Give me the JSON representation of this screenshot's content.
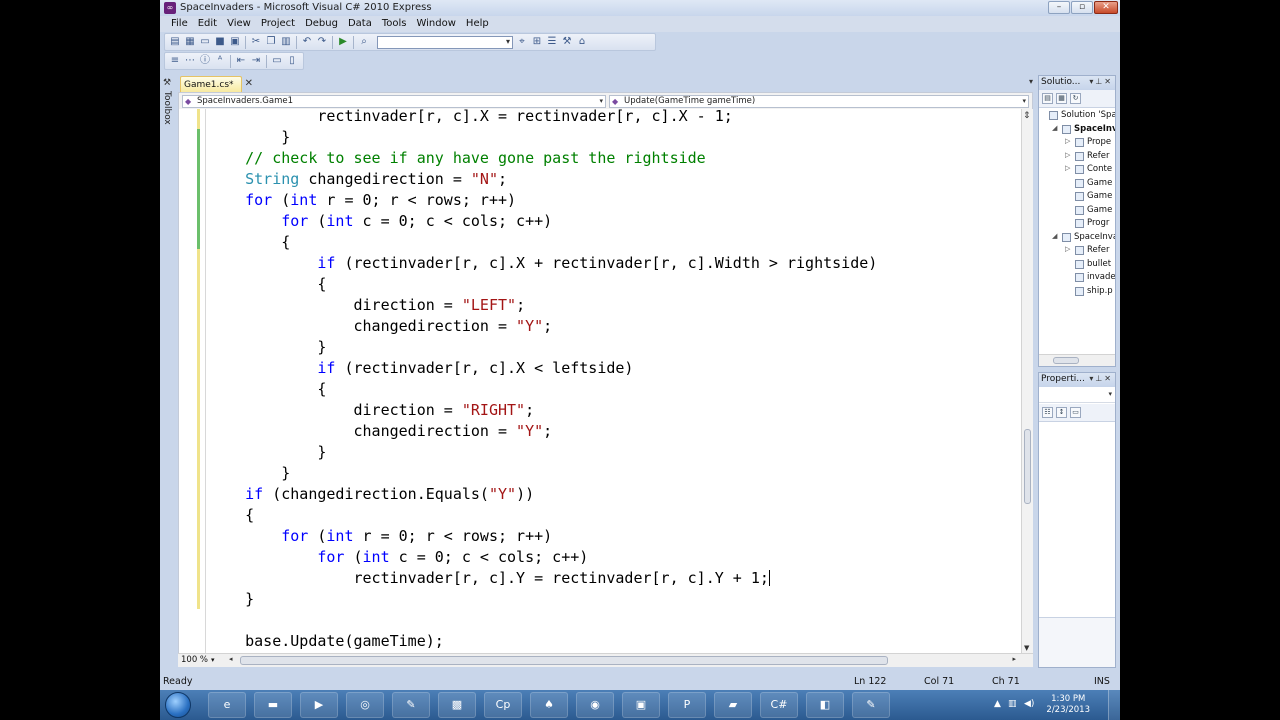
{
  "window": {
    "title": "SpaceInvaders - Microsoft Visual C# 2010 Express"
  },
  "menu": [
    "File",
    "Edit",
    "View",
    "Project",
    "Debug",
    "Data",
    "Tools",
    "Window",
    "Help"
  ],
  "toolbox": {
    "label": "Toolbox"
  },
  "tab": {
    "label": "Game1.cs*"
  },
  "nav": {
    "class": "SpaceInvaders.Game1",
    "member": "Update(GameTime gameTime)"
  },
  "code_lines": [
    [
      [
        "            rectinvader[r, c].X = rectinvader[r, c].X - 1;",
        ""
      ]
    ],
    [
      [
        "        }",
        ""
      ]
    ],
    [
      [
        "    // check to see if any have gone past the rightside",
        "cm"
      ]
    ],
    [
      [
        "    ",
        ""
      ],
      [
        "String",
        "ty"
      ],
      [
        " changedirection = ",
        ""
      ],
      [
        "\"N\"",
        "st"
      ],
      [
        ";",
        ""
      ]
    ],
    [
      [
        "    ",
        ""
      ],
      [
        "for",
        "kw"
      ],
      [
        " (",
        ""
      ],
      [
        "int",
        "kw"
      ],
      [
        " r = 0; r < rows; r++)",
        ""
      ]
    ],
    [
      [
        "        ",
        ""
      ],
      [
        "for",
        "kw"
      ],
      [
        " (",
        ""
      ],
      [
        "int",
        "kw"
      ],
      [
        " c = 0; c < cols; c++)",
        ""
      ]
    ],
    [
      [
        "        {",
        ""
      ]
    ],
    [
      [
        "            ",
        ""
      ],
      [
        "if",
        "kw"
      ],
      [
        " (rectinvader[r, c].X + rectinvader[r, c].Width > rightside)",
        ""
      ]
    ],
    [
      [
        "            {",
        ""
      ]
    ],
    [
      [
        "                direction = ",
        ""
      ],
      [
        "\"LEFT\"",
        "st"
      ],
      [
        ";",
        ""
      ]
    ],
    [
      [
        "                changedirection = ",
        ""
      ],
      [
        "\"Y\"",
        "st"
      ],
      [
        ";",
        ""
      ]
    ],
    [
      [
        "            }",
        ""
      ]
    ],
    [
      [
        "            ",
        ""
      ],
      [
        "if",
        "kw"
      ],
      [
        " (rectinvader[r, c].X < leftside)",
        ""
      ]
    ],
    [
      [
        "            {",
        ""
      ]
    ],
    [
      [
        "                direction = ",
        ""
      ],
      [
        "\"RIGHT\"",
        "st"
      ],
      [
        ";",
        ""
      ]
    ],
    [
      [
        "                changedirection = ",
        ""
      ],
      [
        "\"Y\"",
        "st"
      ],
      [
        ";",
        ""
      ]
    ],
    [
      [
        "            }",
        ""
      ]
    ],
    [
      [
        "        }",
        ""
      ]
    ],
    [
      [
        "    ",
        ""
      ],
      [
        "if",
        "kw"
      ],
      [
        " (changedirection.Equals(",
        ""
      ],
      [
        "\"Y\"",
        "st"
      ],
      [
        "))",
        ""
      ]
    ],
    [
      [
        "    {",
        ""
      ]
    ],
    [
      [
        "        ",
        ""
      ],
      [
        "for",
        "kw"
      ],
      [
        " (",
        ""
      ],
      [
        "int",
        "kw"
      ],
      [
        " r = 0; r < rows; r++)",
        ""
      ]
    ],
    [
      [
        "            ",
        ""
      ],
      [
        "for",
        "kw"
      ],
      [
        " (",
        ""
      ],
      [
        "int",
        "kw"
      ],
      [
        " c = 0; c < cols; c++)",
        ""
      ]
    ],
    [
      [
        "                rectinvader[r, c].Y = rectinvader[r, c].Y + 1;",
        ""
      ],
      [
        "|caret|",
        "caret"
      ]
    ],
    [
      [
        "    }",
        ""
      ]
    ],
    [
      [
        "",
        ""
      ]
    ],
    [
      [
        "    base.Update(gameTime);",
        ""
      ]
    ]
  ],
  "editor": {
    "zoom": "100 %"
  },
  "solution_explorer": {
    "title": "Solutio...",
    "items": [
      {
        "label": "Solution 'Spa",
        "indent": 0,
        "expander": ""
      },
      {
        "label": "SpaceInv",
        "indent": 1,
        "expander": "◢",
        "bold": true
      },
      {
        "label": "Prope",
        "indent": 2,
        "expander": "▷"
      },
      {
        "label": "Refer",
        "indent": 2,
        "expander": "▷"
      },
      {
        "label": "Conte",
        "indent": 2,
        "expander": "▷"
      },
      {
        "label": "Game",
        "indent": 2,
        "expander": ""
      },
      {
        "label": "Game",
        "indent": 2,
        "expander": ""
      },
      {
        "label": "Game",
        "indent": 2,
        "expander": ""
      },
      {
        "label": "Progr",
        "indent": 2,
        "expander": ""
      },
      {
        "label": "SpaceInva",
        "indent": 1,
        "expander": "◢"
      },
      {
        "label": "Refer",
        "indent": 2,
        "expander": "▷"
      },
      {
        "label": "bullet",
        "indent": 2,
        "expander": ""
      },
      {
        "label": "invade",
        "indent": 2,
        "expander": ""
      },
      {
        "label": "ship.p",
        "indent": 2,
        "expander": ""
      }
    ]
  },
  "properties": {
    "title": "Properti..."
  },
  "status": {
    "ready": "Ready",
    "ln": "Ln 122",
    "col": "Col 71",
    "ch": "Ch 71",
    "ins": "INS"
  },
  "taskbar": {
    "time": "1:30 PM",
    "date": "2/23/2013"
  }
}
